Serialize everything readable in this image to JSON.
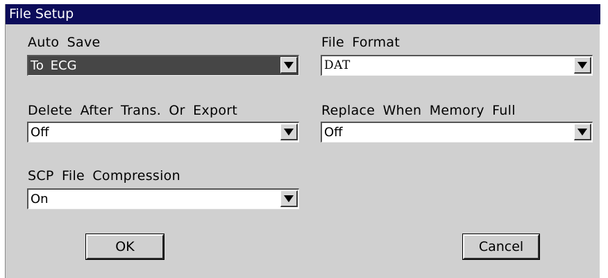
{
  "window": {
    "title": "File Setup"
  },
  "fields": {
    "auto_save": {
      "label": "Auto Save",
      "value": "To ECG"
    },
    "file_format": {
      "label": "File Format",
      "value": "DAT"
    },
    "delete_after": {
      "label": "Delete After Trans. Or Export",
      "value": "Off"
    },
    "replace_full": {
      "label": "Replace When Memory Full",
      "value": "Off"
    },
    "scp_compression": {
      "label": "SCP File Compression",
      "value": "On"
    }
  },
  "buttons": {
    "ok": "OK",
    "cancel": "Cancel"
  },
  "colors": {
    "titlebar": "#0c0c5a",
    "panel": "#d0d0d0",
    "selected_field": "#464646"
  },
  "icons": {
    "dropdown": "dropdown-arrow-icon"
  }
}
